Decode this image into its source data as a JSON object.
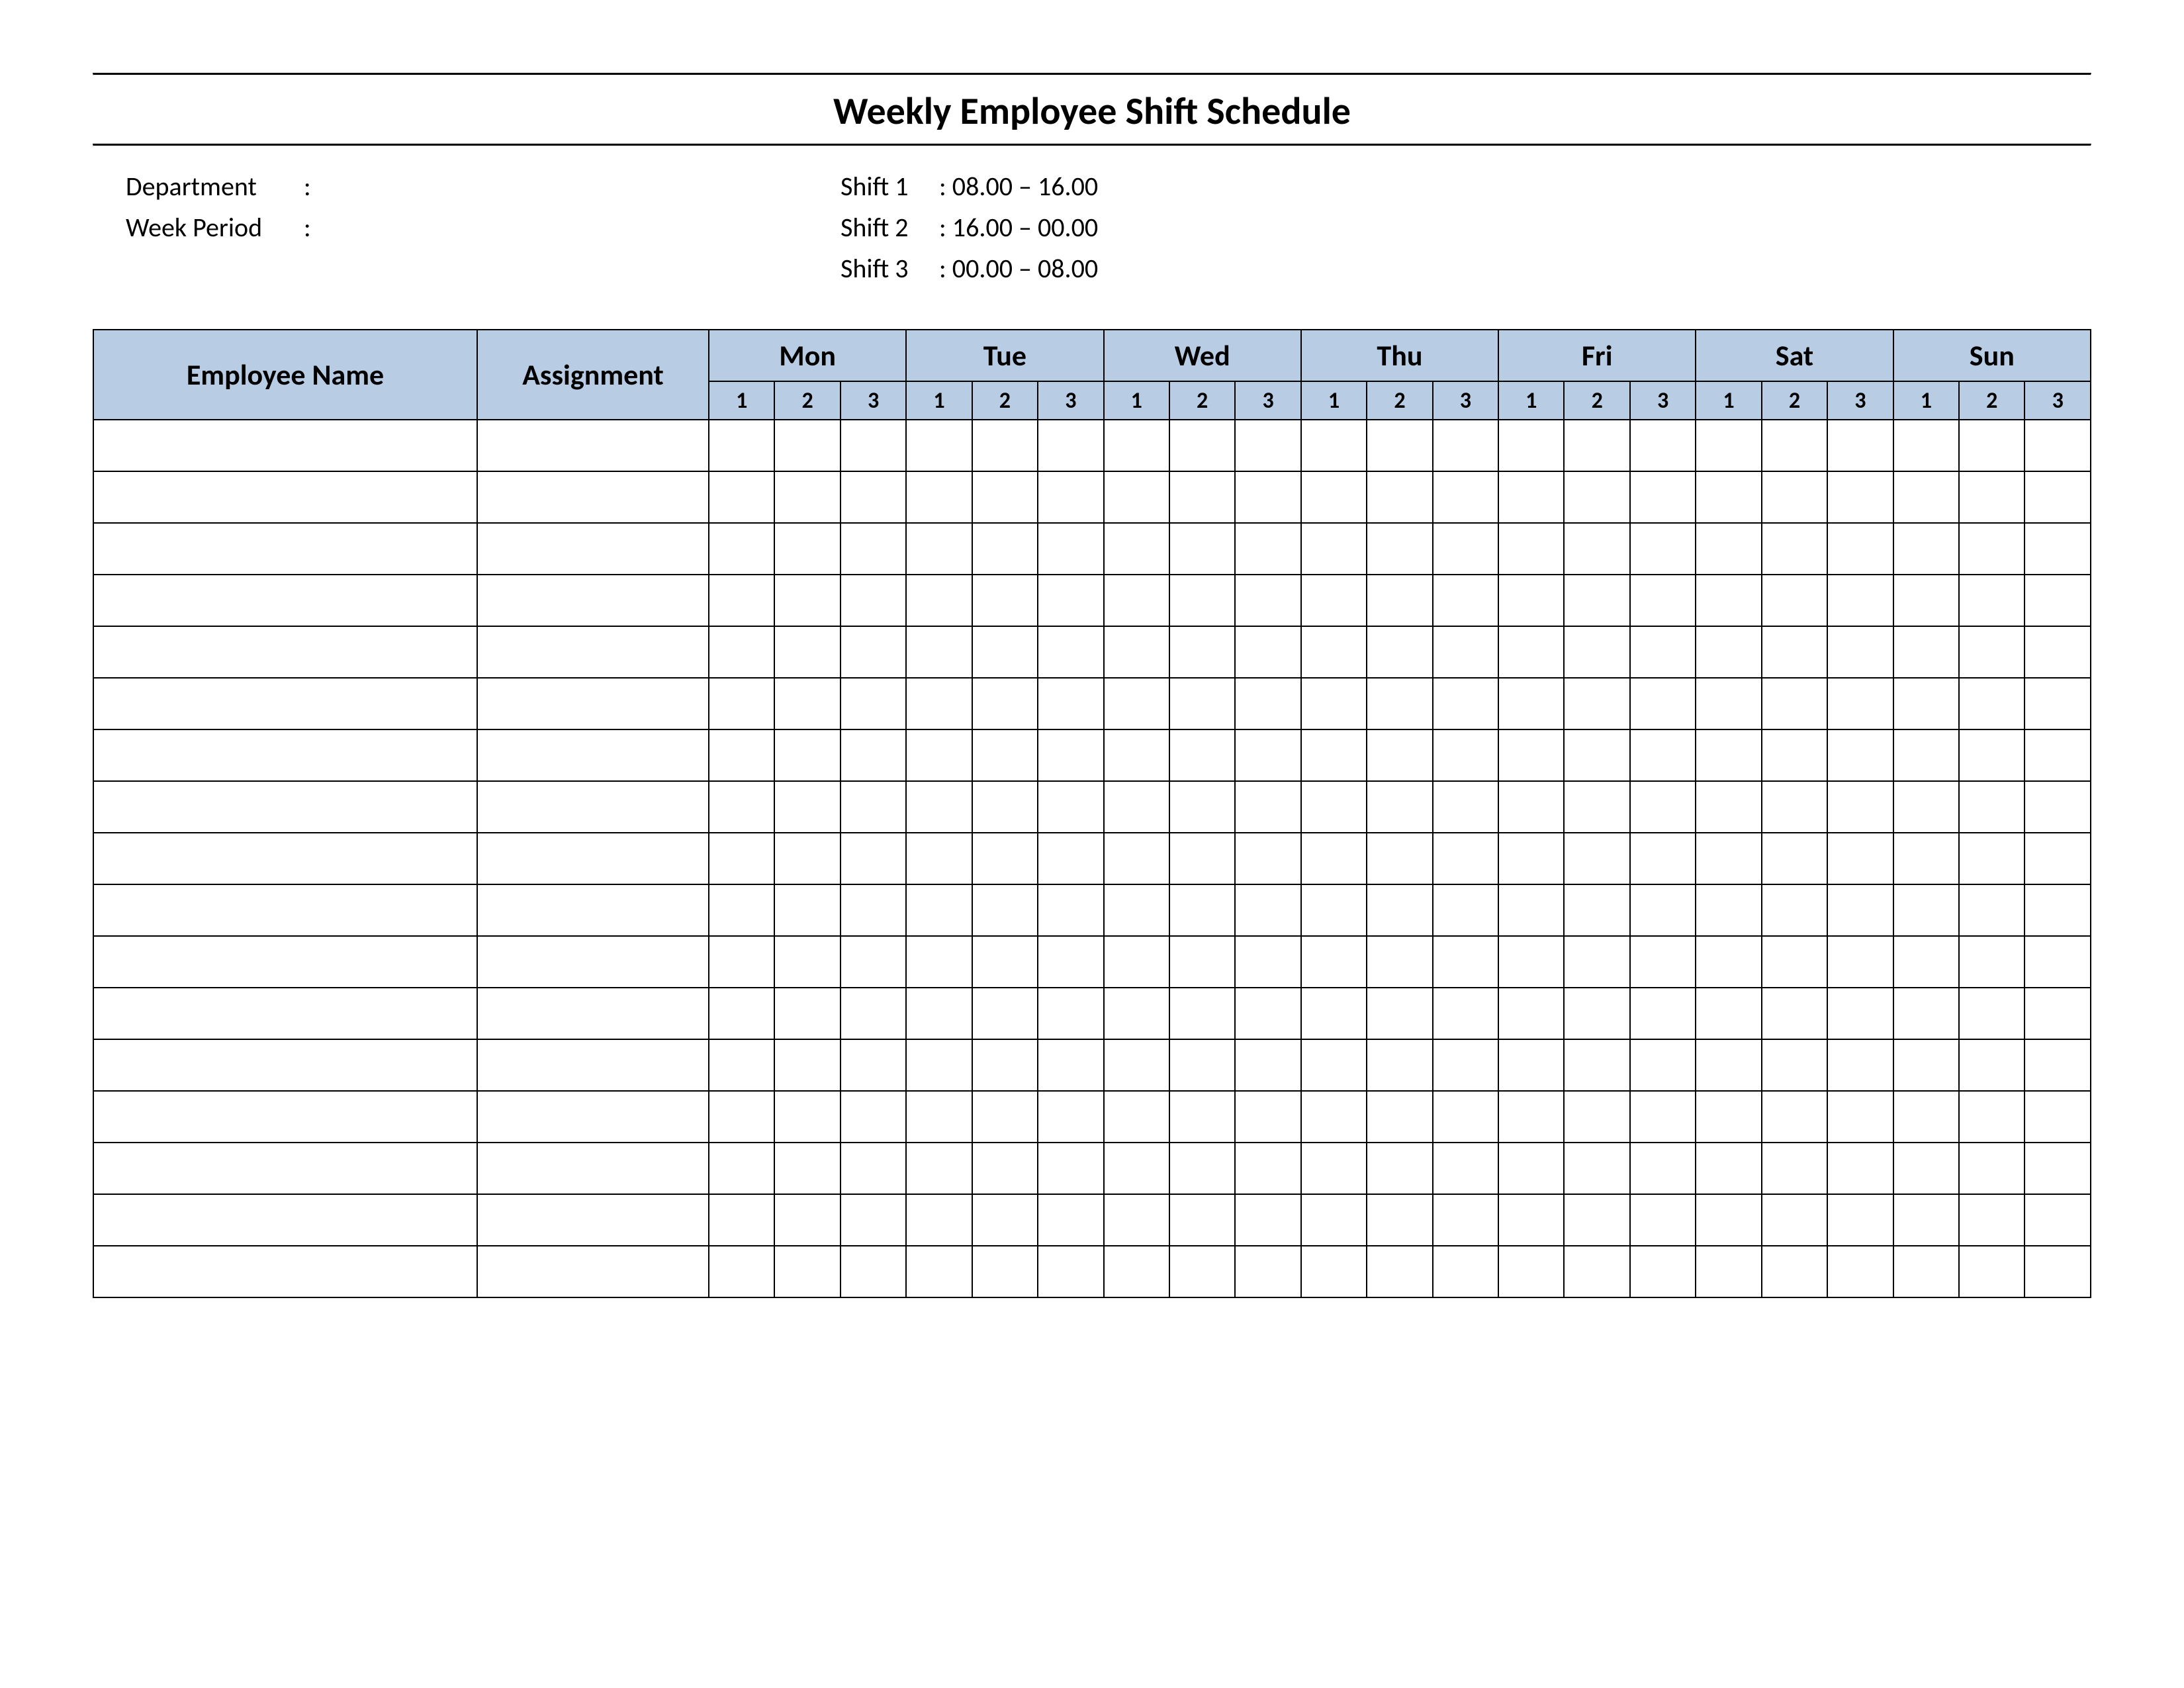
{
  "title": "Weekly Employee Shift Schedule",
  "meta": {
    "department_label": "Department",
    "department_sep": ":",
    "department_value": "",
    "week_period_label": "Week  Period",
    "week_period_sep": ":",
    "week_period_value": "",
    "shift1_label": "Shift 1",
    "shift1_value": ": 08.00  – 16.00",
    "shift2_label": "Shift 2",
    "shift2_value": ": 16.00  – 00.00",
    "shift3_label": "Shift 3",
    "shift3_value": ": 00.00  – 08.00"
  },
  "headers": {
    "employee_name": "Employee Name",
    "assignment": "Assignment",
    "days": [
      "Mon",
      "Tue",
      "Wed",
      "Thu",
      "Fri",
      "Sat",
      "Sun"
    ],
    "shifts": [
      "1",
      "2",
      "3"
    ]
  },
  "row_count": 17
}
